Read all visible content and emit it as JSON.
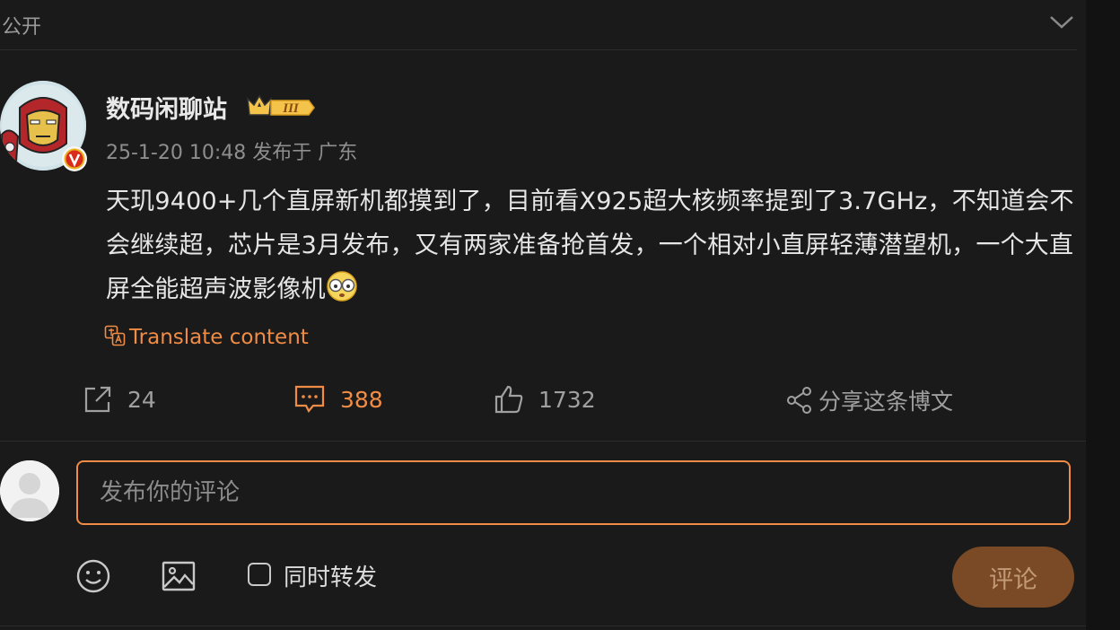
{
  "header": {
    "visibility": "公开"
  },
  "post": {
    "author": "数码闲聊站",
    "level_badge": "III",
    "timestamp": "25-1-20 10:48",
    "location": "发布于 广东",
    "text": "天玑9400+几个直屏新机都摸到了，目前看X925超大核频率提到了3.7GHz，不知道会不会继续超，芯片是3月发布，又有两家准备抢首发，一个相对小直屏轻薄潜望机，一个大直屏全能超声波影像机",
    "translate_label": "Translate content"
  },
  "actions": {
    "repost_count": "24",
    "comment_count": "388",
    "like_count": "1732",
    "share_label": "分享这条博文"
  },
  "composer": {
    "placeholder": "发布你的评论",
    "repost_label": "同时转发",
    "submit_label": "评论"
  },
  "colors": {
    "accent": "#f08c45",
    "background": "#1a1a1a",
    "verified": "#e8b220"
  }
}
